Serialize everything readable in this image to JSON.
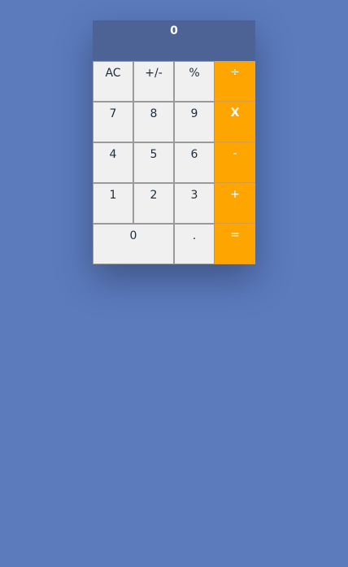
{
  "display": {
    "value": "0"
  },
  "keys": {
    "ac": "AC",
    "sign": "+/-",
    "percent": "%",
    "divide": "÷",
    "seven": "7",
    "eight": "8",
    "nine": "9",
    "multiply": "X",
    "four": "4",
    "five": "5",
    "six": "6",
    "subtract": "-",
    "one": "1",
    "two": "2",
    "three": "3",
    "add": "+",
    "zero": "0",
    "decimal": ".",
    "equals": "="
  },
  "colors": {
    "background": "#5b7bbd",
    "display": "#4d6396",
    "key": "#f0f0f0",
    "operator": "#ffa500"
  }
}
